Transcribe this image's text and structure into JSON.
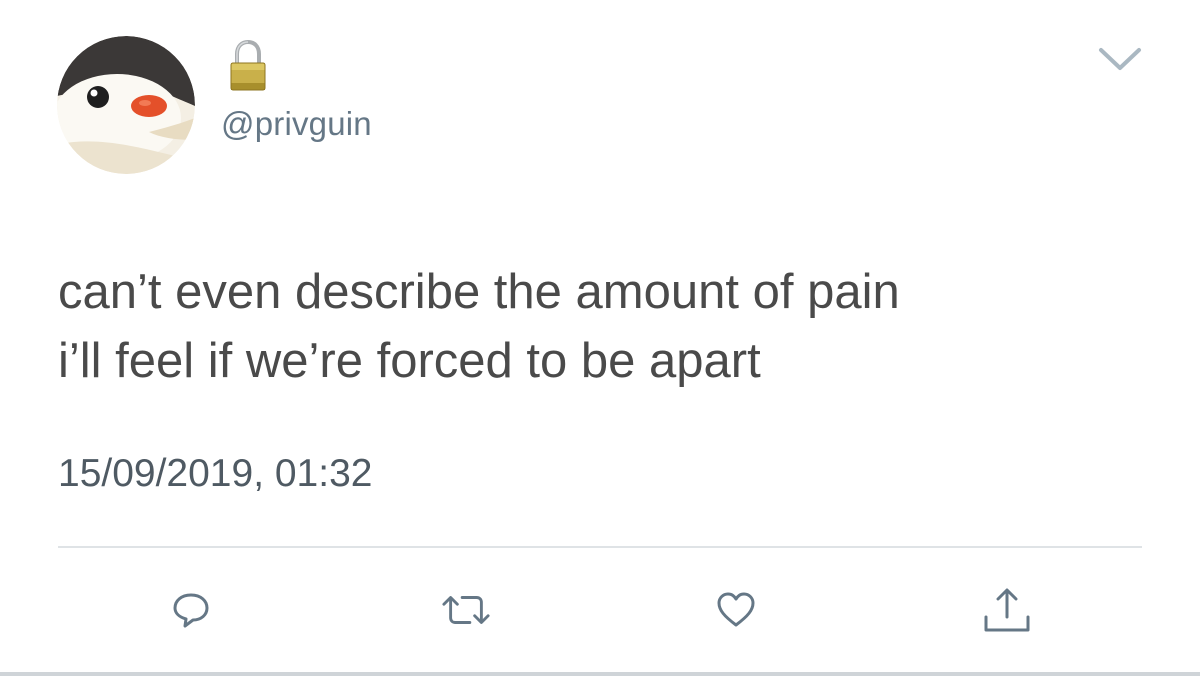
{
  "account": {
    "handle": "@privguin",
    "avatar_icon": "penguin-avatar-icon",
    "locked_icon": "lock-icon"
  },
  "tweet": {
    "text_lines": [
      "can’t even describe the amount of pain",
      "i’ll feel if we’re forced to be apart"
    ],
    "timestamp": "15/09/2019, 01:32"
  },
  "menu": {
    "icon": "chevron-down-icon"
  },
  "actions": [
    {
      "icon": "reply-icon"
    },
    {
      "icon": "retweet-icon"
    },
    {
      "icon": "like-icon"
    },
    {
      "icon": "share-icon"
    }
  ],
  "colors": {
    "text": "#4a4a4a",
    "muted": "#657786",
    "icon": "#657786",
    "divider": "#dfe3e6"
  }
}
